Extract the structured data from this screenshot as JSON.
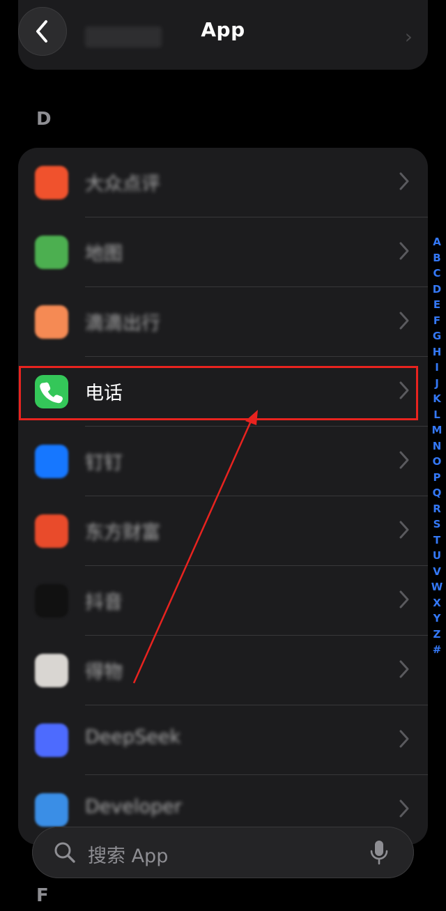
{
  "header": {
    "title": "App",
    "top_blurred_label": "稻壳日"
  },
  "sections": {
    "d": "D",
    "f": "F"
  },
  "apps": [
    {
      "label": "大众点评",
      "icon": "dianping-icon",
      "color": "#f0522d",
      "blurred": true
    },
    {
      "label": "地图",
      "icon": "maps-icon",
      "color": "#4caf50",
      "blurred": true
    },
    {
      "label": "滴滴出行",
      "icon": "didi-icon",
      "color": "#f58a54",
      "blurred": true
    },
    {
      "label": "电话",
      "icon": "phone-icon",
      "color": "#34c759",
      "blurred": false
    },
    {
      "label": "钉钉",
      "icon": "dingtalk-icon",
      "color": "#1677ff",
      "blurred": true
    },
    {
      "label": "东方财富",
      "icon": "eastmoney-icon",
      "color": "#e94b2b",
      "blurred": true
    },
    {
      "label": "抖音",
      "icon": "douyin-icon",
      "color": "#111111",
      "blurred": true
    },
    {
      "label": "得物",
      "icon": "dewu-icon",
      "color": "#d9d6d2",
      "blurred": true
    },
    {
      "label": "DeepSeek",
      "icon": "deepseek-icon",
      "color": "#4d6bfe",
      "blurred": true
    },
    {
      "label": "Developer",
      "icon": "developer-icon",
      "color": "#3a8ee6",
      "blurred": true
    }
  ],
  "alpha_index": [
    "A",
    "B",
    "C",
    "D",
    "E",
    "F",
    "G",
    "H",
    "I",
    "J",
    "K",
    "L",
    "M",
    "N",
    "O",
    "P",
    "Q",
    "R",
    "S",
    "T",
    "U",
    "V",
    "W",
    "X",
    "Y",
    "Z",
    "#"
  ],
  "search": {
    "placeholder": "搜索 App"
  },
  "colors": {
    "highlight": "#e8231f",
    "accent": "#3478f6"
  }
}
